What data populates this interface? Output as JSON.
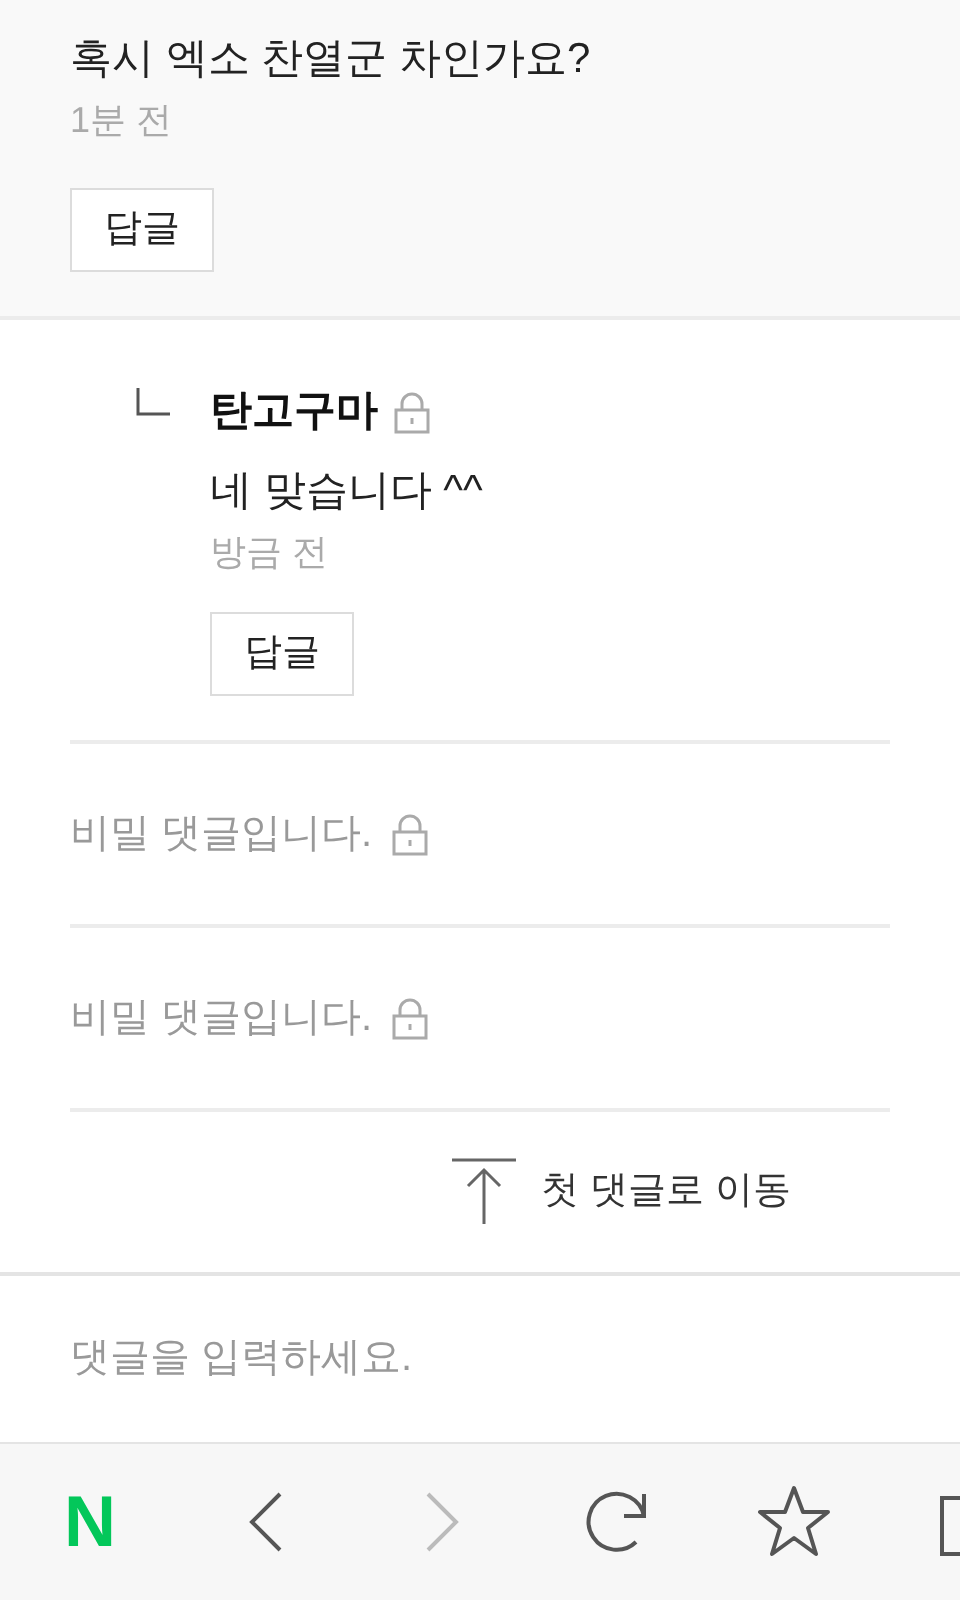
{
  "comments": [
    {
      "kind": "comment",
      "text": "혹시 엑소 찬열군 차인가요?",
      "time": "1분 전",
      "reply_button": "답글"
    },
    {
      "kind": "reply",
      "author": "탄고구마",
      "locked": true,
      "text": "네 맞습니다 ^^",
      "time": "방금 전",
      "reply_button": "답글"
    },
    {
      "kind": "secret",
      "text": "비밀 댓글입니다.",
      "locked": true
    },
    {
      "kind": "secret",
      "text": "비밀 댓글입니다.",
      "locked": true
    }
  ],
  "jump_to_first": {
    "label": "첫 댓글로 이동"
  },
  "comment_input": {
    "placeholder": "댓글을 입력하세요."
  },
  "browser_toolbar": {
    "logo": "N",
    "items": [
      {
        "kind": "back",
        "disabled": false
      },
      {
        "kind": "forward",
        "disabled": true
      },
      {
        "kind": "reload",
        "disabled": false
      },
      {
        "kind": "bookmark",
        "disabled": false
      },
      {
        "kind": "tabs",
        "disabled": false
      }
    ]
  }
}
